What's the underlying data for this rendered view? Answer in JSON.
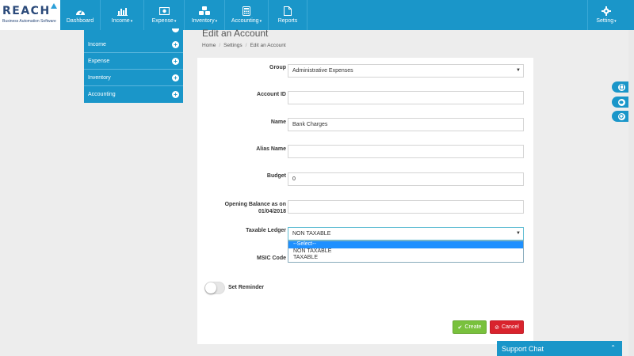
{
  "brand": {
    "name": "Reach",
    "tagline": "Business Automation Software"
  },
  "nav": {
    "items": [
      {
        "label": "Dashboard",
        "icon": "dashboard-icon",
        "caret": ""
      },
      {
        "label": "Income",
        "icon": "bar-chart-icon",
        "caret": "▾"
      },
      {
        "label": "Expense",
        "icon": "money-icon",
        "caret": "▾"
      },
      {
        "label": "Inventory",
        "icon": "cubes-icon",
        "caret": "▾"
      },
      {
        "label": "Accounting",
        "icon": "calculator-icon",
        "caret": "▾"
      },
      {
        "label": "Reports",
        "icon": "file-icon",
        "caret": ""
      }
    ],
    "setting": {
      "label": "Setting",
      "caret": "▾",
      "icon": "gear-icon"
    }
  },
  "sidebar": {
    "items": [
      {
        "label": "Income"
      },
      {
        "label": "Expense"
      },
      {
        "label": "Inventory"
      },
      {
        "label": "Accounting"
      }
    ],
    "plus": "+"
  },
  "page": {
    "title": "Edit an Account",
    "breadcrumb": [
      "Home",
      "Settings",
      "Edit an Account"
    ],
    "breadcrumb_sep": "/"
  },
  "form": {
    "group": {
      "label": "Group",
      "value": "Administrative Expenses"
    },
    "account_id": {
      "label": "Account ID",
      "value": ""
    },
    "name": {
      "label": "Name",
      "value": "Bank Charges"
    },
    "alias_name": {
      "label": "Alias Name",
      "value": ""
    },
    "budget": {
      "label": "Budget",
      "value": "0"
    },
    "opening_balance": {
      "label_line1": "Opening Balance as on",
      "label_line2": "01/04/2018",
      "value": ""
    },
    "taxable_ledger": {
      "label": "Taxable Ledger",
      "value": "NON TAXABLE",
      "options": [
        "--Select--",
        "NON TAXABLE",
        "TAXABLE"
      ],
      "highlighted_index": 0
    },
    "msic_code": {
      "label": "MSIC Code",
      "value": ""
    },
    "reminder": {
      "label": "Set Reminder",
      "on": false
    },
    "create_label": "Create",
    "cancel_label": "Cancel",
    "select_arrow": "▼"
  },
  "chat": {
    "label": "Support Chat",
    "chevron": "⌃"
  },
  "colors": {
    "brand": "#1a96c9",
    "create": "#79c13d",
    "cancel": "#d9232d"
  }
}
